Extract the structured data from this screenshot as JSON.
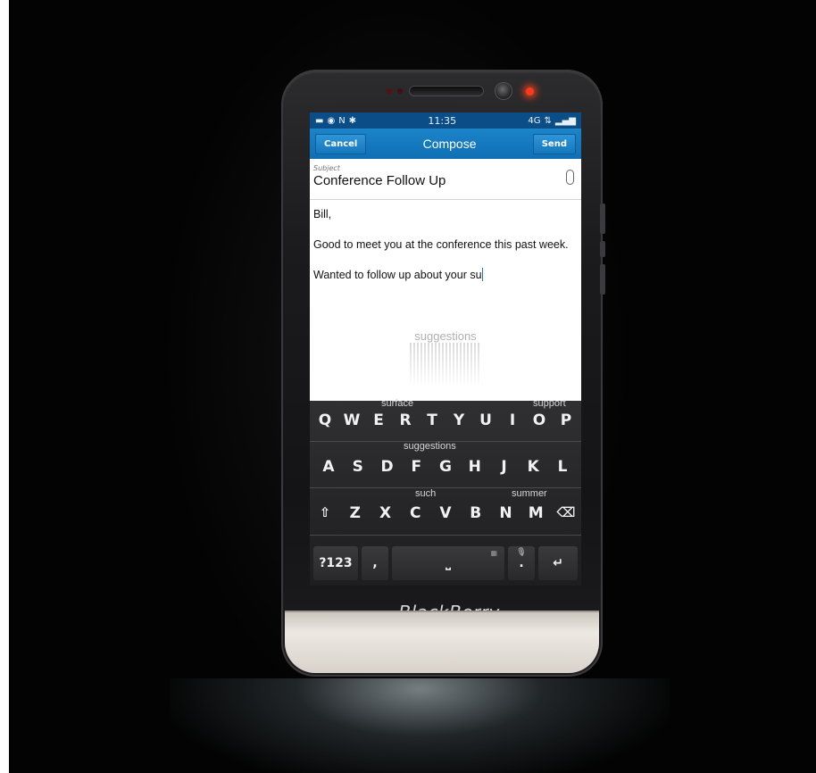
{
  "status_bar": {
    "time": "11:35",
    "left_icons": [
      "battery-icon",
      "notification-icon",
      "nfc-icon",
      "bluetooth-icon"
    ],
    "network": "4G",
    "right_icons": [
      "data-arrows-icon",
      "signal-icon"
    ]
  },
  "compose": {
    "title": "Compose",
    "cancel_label": "Cancel",
    "send_label": "Send",
    "subject_label": "Subject",
    "subject_value": "Conference Follow Up",
    "body": {
      "line1": "Bill,",
      "line2": "Good to meet you at the conference this past week.",
      "line3": "Wanted to follow up about your su"
    },
    "suggestion_hint": "suggestions"
  },
  "keyboard": {
    "word_suggestions": {
      "w1": "surface",
      "w2": "support",
      "w3": "suggestions",
      "w4": "such",
      "w5": "summer"
    },
    "row1": [
      "Q",
      "W",
      "E",
      "R",
      "T",
      "Y",
      "U",
      "I",
      "O",
      "P"
    ],
    "row2": [
      "A",
      "S",
      "D",
      "F",
      "G",
      "H",
      "J",
      "K",
      "L"
    ],
    "row3": [
      "Z",
      "X",
      "C",
      "V",
      "B",
      "N",
      "M"
    ],
    "symbols_key": "?123",
    "comma_key": ",",
    "period_key": "."
  },
  "device": {
    "brand": "BlackBerry"
  },
  "colors": {
    "title_bar": "#0f6fb5",
    "status_bar": "#0b4e87",
    "keyboard": "#1e1e20",
    "cursor": "#1a7ac4"
  }
}
